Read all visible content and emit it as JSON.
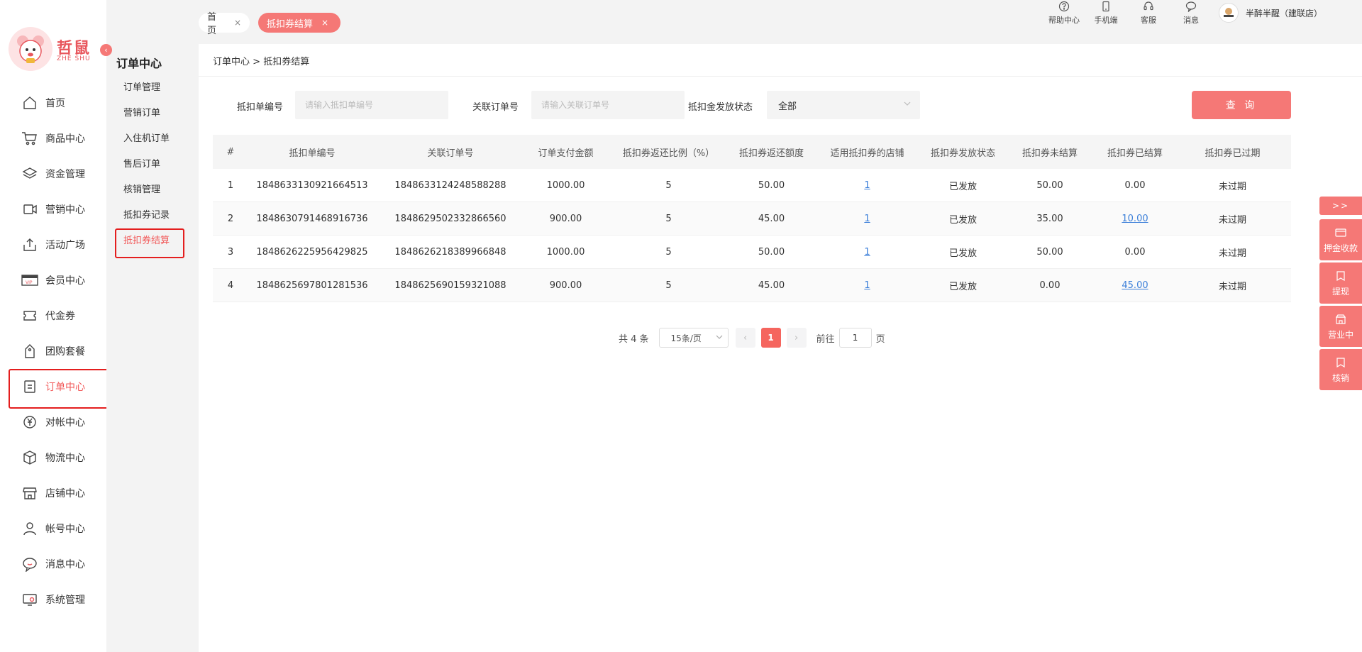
{
  "logo": {
    "text": "哲鼠",
    "sub": "ZHE SHU"
  },
  "nav": [
    {
      "label": "首页",
      "icon": "home-icon"
    },
    {
      "label": "商品中心",
      "icon": "cart-icon"
    },
    {
      "label": "资金管理",
      "icon": "layers-icon"
    },
    {
      "label": "营销中心",
      "icon": "marketing-icon"
    },
    {
      "label": "活动广场",
      "icon": "upload-box-icon"
    },
    {
      "label": "会员中心",
      "icon": "vip-card-icon"
    },
    {
      "label": "代金券",
      "icon": "ticket-icon"
    },
    {
      "label": "团购套餐",
      "icon": "price-tag-icon"
    },
    {
      "label": "订单中心",
      "icon": "order-doc-icon",
      "active": true
    },
    {
      "label": "对帐中心",
      "icon": "yen-circle-icon"
    },
    {
      "label": "物流中心",
      "icon": "cube-icon"
    },
    {
      "label": "店铺中心",
      "icon": "storefront-icon"
    },
    {
      "label": "帐号中心",
      "icon": "user-icon"
    },
    {
      "label": "消息中心",
      "icon": "chat-bubble-icon"
    },
    {
      "label": "系统管理",
      "icon": "settings-monitor-icon"
    }
  ],
  "subnav": {
    "title": "订单中心",
    "items": [
      "订单管理",
      "营销订单",
      "入住机订单",
      "售后订单",
      "核销管理",
      "抵扣券记录",
      "抵扣券结算"
    ],
    "active_index": 6
  },
  "tabs": [
    {
      "label": "首页",
      "close": "×"
    },
    {
      "label": "抵扣券结算",
      "close": "×"
    }
  ],
  "toolbar": {
    "help": "帮助中心",
    "mobile": "手机端",
    "service": "客服",
    "message": "消息",
    "user": "半醉半醒（建联店）"
  },
  "breadcrumb": {
    "parent": "订单中心",
    "sep": " > ",
    "current": "抵扣券结算"
  },
  "filters": {
    "voucher_no_label": "抵扣单编号",
    "voucher_no_placeholder": "请输入抵扣单编号",
    "voucher_no_value": "",
    "order_no_label": "关联订单号",
    "order_no_placeholder": "请输入关联订单号",
    "order_no_value": "",
    "status_label": "抵扣金发放状态",
    "status_value": "全部",
    "query_label": "查 询"
  },
  "table": {
    "headers": [
      "#",
      "抵扣单编号",
      "关联订单号",
      "订单支付金额",
      "抵扣券返还比例（%）",
      "抵扣券返还额度",
      "适用抵扣券的店铺",
      "抵扣券发放状态",
      "抵扣券未结算",
      "抵扣券已结算",
      "抵扣券已过期"
    ],
    "rows": [
      [
        "1",
        "1848633130921664513",
        "1848633124248588288",
        "1000.00",
        "5",
        "50.00",
        "1",
        "已发放",
        "50.00",
        "0.00",
        "未过期"
      ],
      [
        "2",
        "1848630791468916736",
        "1848629502332866560",
        "900.00",
        "5",
        "45.00",
        "1",
        "已发放",
        "35.00",
        "10.00",
        "未过期"
      ],
      [
        "3",
        "1848626225956429825",
        "1848626218389966848",
        "1000.00",
        "5",
        "50.00",
        "1",
        "已发放",
        "50.00",
        "0.00",
        "未过期"
      ],
      [
        "4",
        "1848625697801281536",
        "1848625690159321088",
        "900.00",
        "5",
        "45.00",
        "1",
        "已发放",
        "0.00",
        "45.00",
        "未过期"
      ]
    ],
    "settled_link_rows": [
      1,
      3
    ]
  },
  "pagination": {
    "total": "共 4 条",
    "page_size": "15条/页",
    "current": "1",
    "goto_prefix": "前往",
    "goto_value": "1",
    "goto_suffix": "页"
  },
  "float_tools": {
    "expand": ">>",
    "items": [
      "押金收款",
      "提现",
      "营业中",
      "核销"
    ]
  },
  "colors": {
    "accent": "#f57876",
    "active_text": "#f25a5a",
    "highlight_border": "#e41e1e",
    "link": "#3b7fd9"
  }
}
